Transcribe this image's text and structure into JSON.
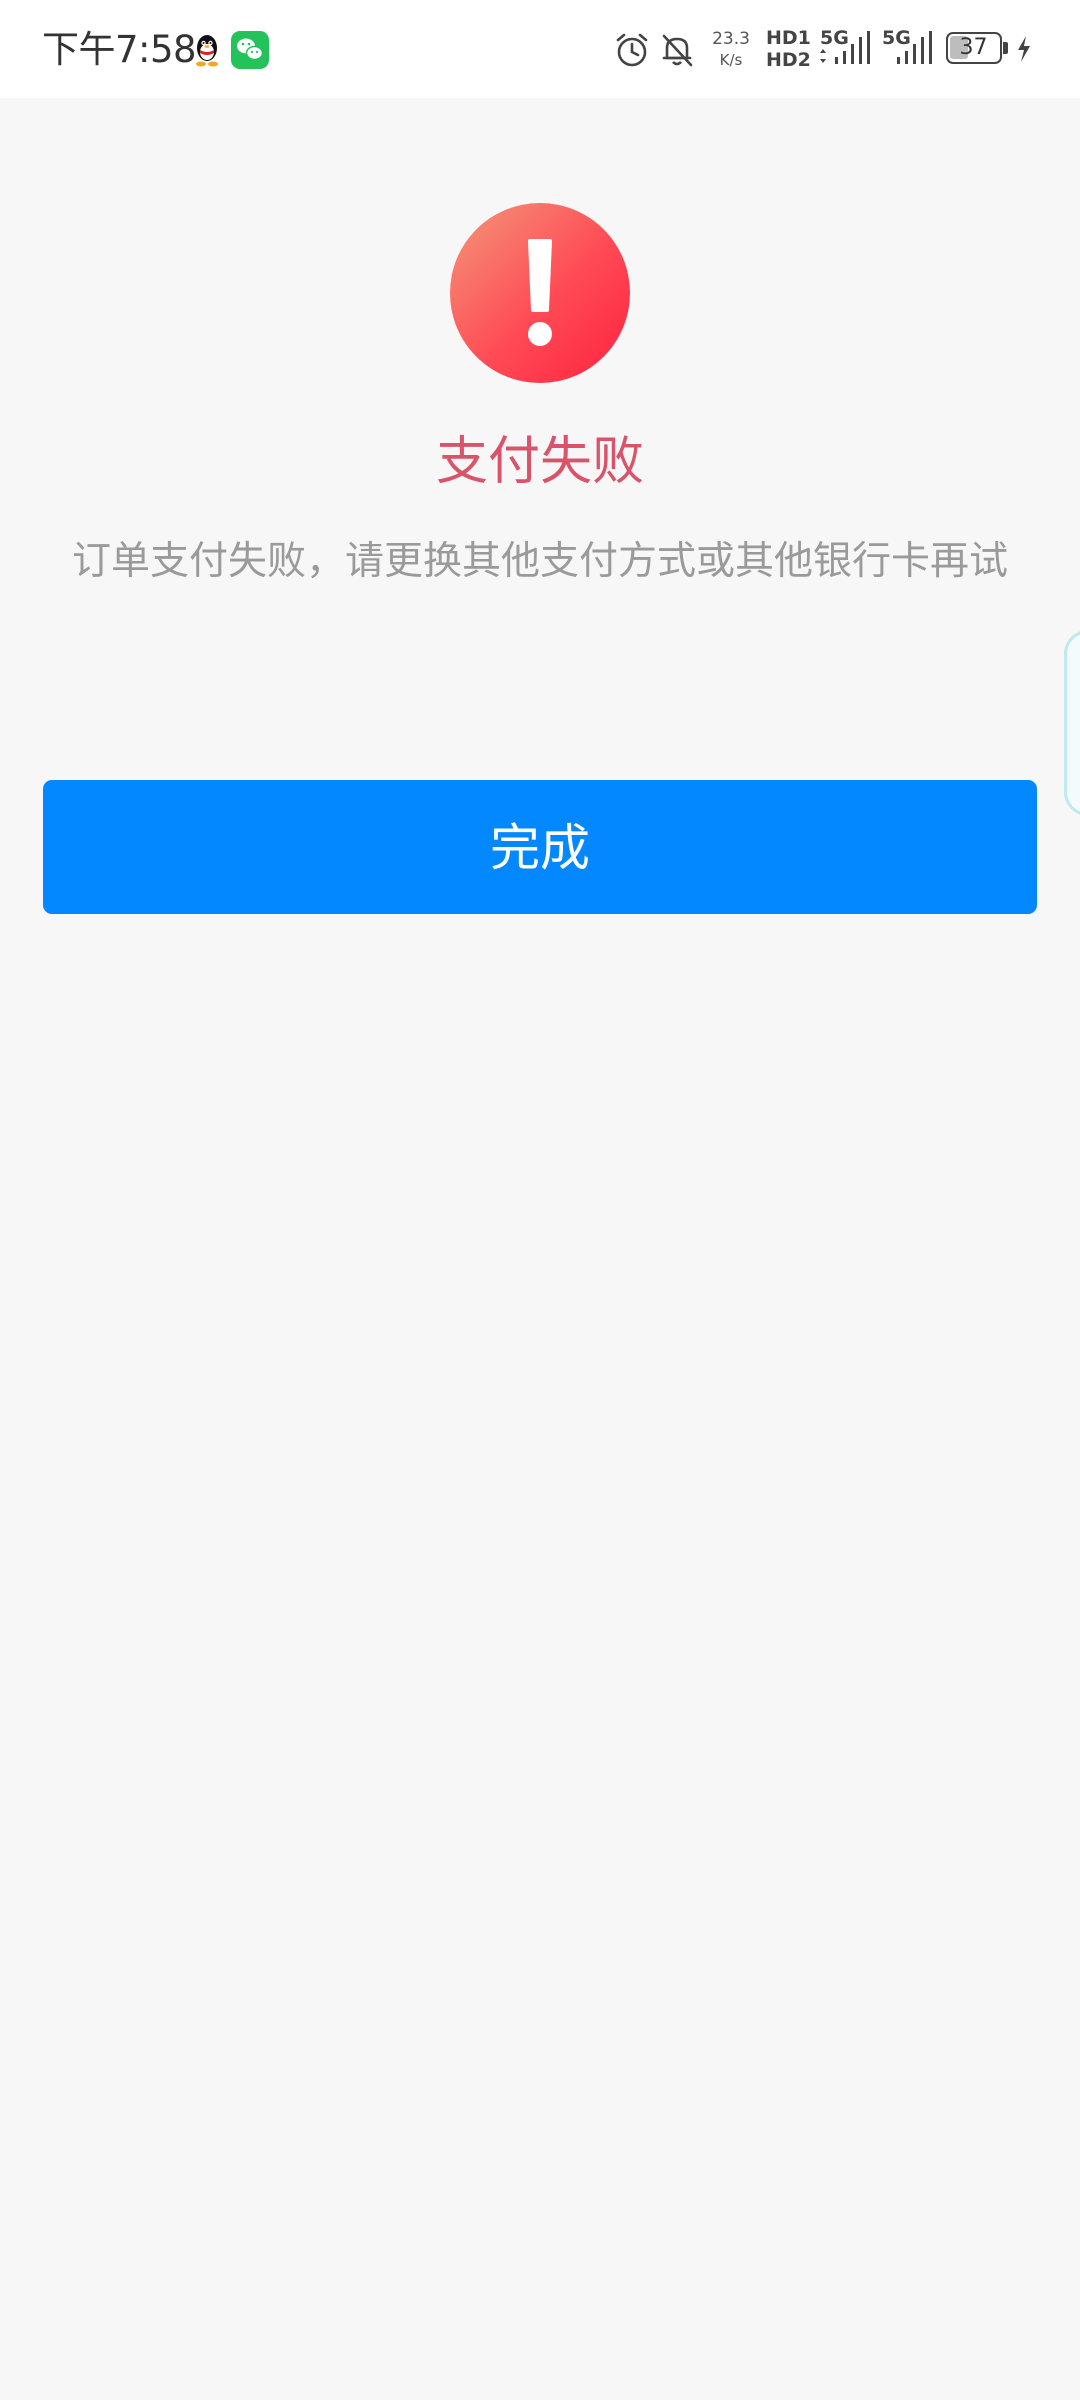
{
  "status_bar": {
    "time": "下午7:58",
    "network_speed_value": "23.3",
    "network_speed_unit": "K/s",
    "hd1": "HD1",
    "hd2": "HD2",
    "sim1_type": "5G",
    "sim2_type": "5G",
    "battery": "37",
    "icons": [
      "qq-icon",
      "wechat-icon",
      "alarm-icon",
      "bell-muted-icon",
      "signal-icon",
      "battery-icon",
      "charging-icon"
    ]
  },
  "result": {
    "title": "支付失败",
    "message": "订单支付失败，请更换其他支付方式或其他银行卡再试",
    "icon": "exclamation-icon"
  },
  "actions": {
    "done_label": "完成"
  },
  "colors": {
    "accent": "#0488ff",
    "error_title": "#d9546b",
    "error_icon_start": "#f4977a",
    "error_icon_end": "#ff2a46",
    "background": "#f7f7f7"
  }
}
